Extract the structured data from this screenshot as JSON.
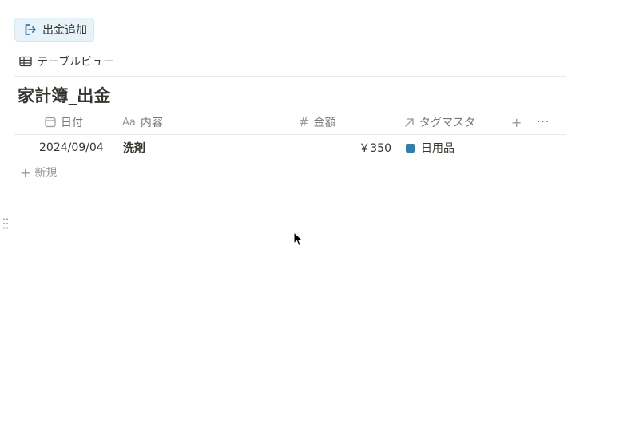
{
  "add_button": {
    "label": "出金追加",
    "icon": "exit-arrow-icon"
  },
  "view_tab": {
    "label": "テーブルビュー",
    "icon": "table-icon"
  },
  "database": {
    "title": "家計簿_出金"
  },
  "columns": [
    {
      "label": "日付",
      "icon": "calendar-icon"
    },
    {
      "label": "内容",
      "icon": "text-aa-icon",
      "icon_text": "Aa"
    },
    {
      "label": "金額",
      "icon": "number-hash-icon",
      "icon_text": "#"
    },
    {
      "label": "タグマスタ",
      "icon": "relation-arrow-icon"
    }
  ],
  "column_actions": {
    "add": "+",
    "more": "···"
  },
  "rows": [
    {
      "date": "2024/09/04",
      "content": "洗剤",
      "amount": "￥350",
      "tag": "日用品",
      "tag_color": "#337ea9"
    }
  ],
  "new_row": {
    "label": "新規",
    "icon": "+"
  },
  "colors": {
    "button_bg": "#e7f3f8",
    "button_icon": "#337ea9",
    "text": "#37352f",
    "muted": "#787774",
    "divider": "#e9e9e7"
  }
}
